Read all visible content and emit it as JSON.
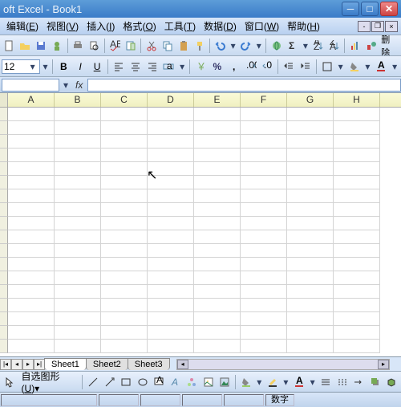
{
  "title": "oft Excel - Book1",
  "menu": {
    "edit": "编辑",
    "edit_u": "E",
    "view": "视图",
    "view_u": "V",
    "insert": "插入",
    "insert_u": "I",
    "format": "格式",
    "format_u": "O",
    "tools": "工具",
    "tools_u": "T",
    "data": "数据",
    "data_u": "D",
    "window": "窗口",
    "window_u": "W",
    "help": "帮助",
    "help_u": "H"
  },
  "toolbar": {
    "font_size": "12",
    "delete_label": "删除"
  },
  "formula": {
    "fx": "fx",
    "name_value": "",
    "formula_value": ""
  },
  "columns": [
    "A",
    "B",
    "C",
    "D",
    "E",
    "F",
    "G",
    "H"
  ],
  "row_count": 18,
  "sheets": {
    "s1": "Sheet1",
    "s2": "Sheet2",
    "s3": "Sheet3"
  },
  "drawing": {
    "autoshapes": "自选图形",
    "autoshapes_u": "U"
  },
  "status": {
    "num": "数字"
  }
}
